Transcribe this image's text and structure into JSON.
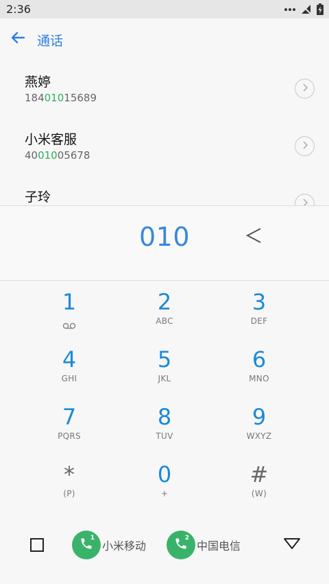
{
  "status": {
    "time": "2:36"
  },
  "header": {
    "title": "通话"
  },
  "contacts": [
    {
      "name": "燕婷",
      "num_pre": "184",
      "num_match": "010",
      "num_post": "15689"
    },
    {
      "name": "小米客服",
      "num_pre": "40",
      "num_match": "010",
      "num_post": "05678"
    },
    {
      "name": "子玲",
      "num_pre": "",
      "num_match": "",
      "num_post": ""
    }
  ],
  "dialer": {
    "number": "010"
  },
  "keypad": [
    {
      "digit": "1",
      "letters": ""
    },
    {
      "digit": "2",
      "letters": "ABC"
    },
    {
      "digit": "3",
      "letters": "DEF"
    },
    {
      "digit": "4",
      "letters": "GHI"
    },
    {
      "digit": "5",
      "letters": "JKL"
    },
    {
      "digit": "6",
      "letters": "MNO"
    },
    {
      "digit": "7",
      "letters": "PQRS"
    },
    {
      "digit": "8",
      "letters": "TUV"
    },
    {
      "digit": "9",
      "letters": "WXYZ"
    },
    {
      "digit": "*",
      "letters": "(P)"
    },
    {
      "digit": "0",
      "letters": "+"
    },
    {
      "digit": "#",
      "letters": "(W)"
    }
  ],
  "bottom": {
    "sim1": {
      "slot": "1",
      "label": "小米移动"
    },
    "sim2": {
      "slot": "2",
      "label": "中国电信"
    }
  },
  "icons": {
    "back": "arrow-left-icon",
    "detail": "chevron-right-icon",
    "backspace": "backspace-icon",
    "voicemail": "voicemail-icon",
    "phone": "phone-icon"
  },
  "colors": {
    "accent": "#2e7fe0",
    "digit": "#1b8ad8",
    "match": "#2fae5a",
    "call": "#39b36a"
  }
}
